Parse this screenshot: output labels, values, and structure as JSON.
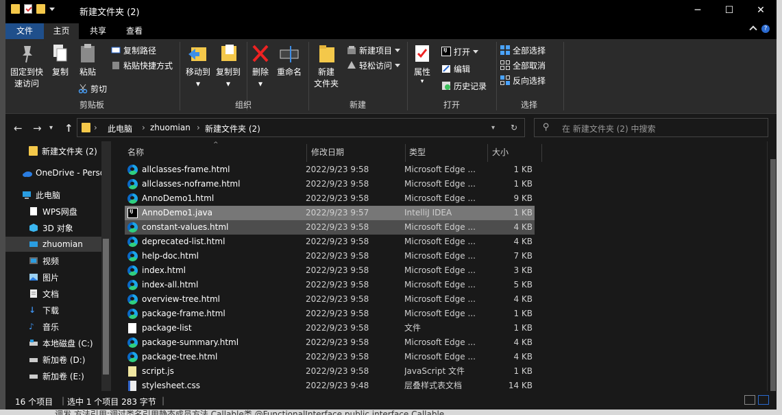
{
  "window": {
    "title": "新建文件夹 (2)",
    "controls": {
      "minimize": "─",
      "maximize": "☐",
      "close": "✕"
    }
  },
  "ribbon_tabs": [
    {
      "label": "文件"
    },
    {
      "label": "主页"
    },
    {
      "label": "共享"
    },
    {
      "label": "查看"
    }
  ],
  "ribbon": {
    "clipboard": {
      "label": "剪贴板",
      "pin": "固定到快\n速访问",
      "copy": "复制",
      "paste": "粘贴",
      "copy_path": "复制路径",
      "paste_shortcut": "粘贴快捷方式",
      "cut": "剪切"
    },
    "organize": {
      "label": "组织",
      "move_to": "移动到",
      "copy_to": "复制到",
      "delete": "删除",
      "rename": "重命名"
    },
    "new": {
      "label": "新建",
      "new_folder": "新建\n文件夹",
      "new_item": "新建项目",
      "easy_access": "轻松访问"
    },
    "open": {
      "label": "打开",
      "properties": "属性",
      "open": "打开",
      "edit": "编辑",
      "history": "历史记录"
    },
    "select": {
      "label": "选择",
      "select_all": "全部选择",
      "select_none": "全部取消",
      "invert": "反向选择"
    }
  },
  "address": {
    "crumbs": [
      "此电脑",
      "zhuomian",
      "新建文件夹 (2)"
    ],
    "search_placeholder": "在 新建文件夹 (2) 中搜索"
  },
  "nav": [
    {
      "label": "新建文件夹 (2)",
      "icon": "folder-icon"
    },
    {
      "label": "OneDrive - Perso",
      "icon": "cloud-icon"
    },
    {
      "label": "此电脑",
      "icon": "computer-icon"
    },
    {
      "label": "WPS网盘",
      "icon": "wps-drive-icon"
    },
    {
      "label": "3D 对象",
      "icon": "cube-icon"
    },
    {
      "label": "zhuomian",
      "icon": "desktop-icon",
      "selected": true
    },
    {
      "label": "视频",
      "icon": "video-icon"
    },
    {
      "label": "图片",
      "icon": "picture-icon"
    },
    {
      "label": "文档",
      "icon": "document-icon"
    },
    {
      "label": "下载",
      "icon": "download-icon"
    },
    {
      "label": "音乐",
      "icon": "music-icon"
    },
    {
      "label": "本地磁盘 (C:)",
      "icon": "drive-icon"
    },
    {
      "label": "新加卷 (D:)",
      "icon": "drive-icon"
    },
    {
      "label": "新加卷 (E:)",
      "icon": "drive-icon"
    }
  ],
  "columns": {
    "name": "名称",
    "date": "修改日期",
    "type": "类型",
    "size": "大小"
  },
  "files": [
    {
      "name": "allclasses-frame.html",
      "date": "2022/9/23 9:58",
      "type": "Microsoft Edge ...",
      "size": "1 KB",
      "icon": "edge"
    },
    {
      "name": "allclasses-noframe.html",
      "date": "2022/9/23 9:58",
      "type": "Microsoft Edge ...",
      "size": "1 KB",
      "icon": "edge"
    },
    {
      "name": "AnnoDemo1.html",
      "date": "2022/9/23 9:58",
      "type": "Microsoft Edge ...",
      "size": "9 KB",
      "icon": "edge"
    },
    {
      "name": "AnnoDemo1.java",
      "date": "2022/9/23 9:57",
      "type": "IntelliJ IDEA",
      "size": "1 KB",
      "icon": "ij",
      "state": "selected"
    },
    {
      "name": "constant-values.html",
      "date": "2022/9/23 9:58",
      "type": "Microsoft Edge ...",
      "size": "4 KB",
      "icon": "edge",
      "state": "hover"
    },
    {
      "name": "deprecated-list.html",
      "date": "2022/9/23 9:58",
      "type": "Microsoft Edge ...",
      "size": "4 KB",
      "icon": "edge"
    },
    {
      "name": "help-doc.html",
      "date": "2022/9/23 9:58",
      "type": "Microsoft Edge ...",
      "size": "7 KB",
      "icon": "edge"
    },
    {
      "name": "index.html",
      "date": "2022/9/23 9:58",
      "type": "Microsoft Edge ...",
      "size": "3 KB",
      "icon": "edge"
    },
    {
      "name": "index-all.html",
      "date": "2022/9/23 9:58",
      "type": "Microsoft Edge ...",
      "size": "5 KB",
      "icon": "edge"
    },
    {
      "name": "overview-tree.html",
      "date": "2022/9/23 9:58",
      "type": "Microsoft Edge ...",
      "size": "4 KB",
      "icon": "edge"
    },
    {
      "name": "package-frame.html",
      "date": "2022/9/23 9:58",
      "type": "Microsoft Edge ...",
      "size": "1 KB",
      "icon": "edge"
    },
    {
      "name": "package-list",
      "date": "2022/9/23 9:58",
      "type": "文件",
      "size": "1 KB",
      "icon": "doc"
    },
    {
      "name": "package-summary.html",
      "date": "2022/9/23 9:58",
      "type": "Microsoft Edge ...",
      "size": "4 KB",
      "icon": "edge"
    },
    {
      "name": "package-tree.html",
      "date": "2022/9/23 9:58",
      "type": "Microsoft Edge ...",
      "size": "4 KB",
      "icon": "edge"
    },
    {
      "name": "script.js",
      "date": "2022/9/23 9:58",
      "type": "JavaScript 文件",
      "size": "1 KB",
      "icon": "js"
    },
    {
      "name": "stylesheet.css",
      "date": "2022/9/23 9:48",
      "type": "层叠样式表文档",
      "size": "14 KB",
      "icon": "css"
    }
  ],
  "status": {
    "count": "16 个项目",
    "selection": "选中 1 个项目  283 字节"
  },
  "background_text": "调发  方法引用:调过类名引用静态成员方法 Callable类 @FunctionalInterface public interface Callable"
}
